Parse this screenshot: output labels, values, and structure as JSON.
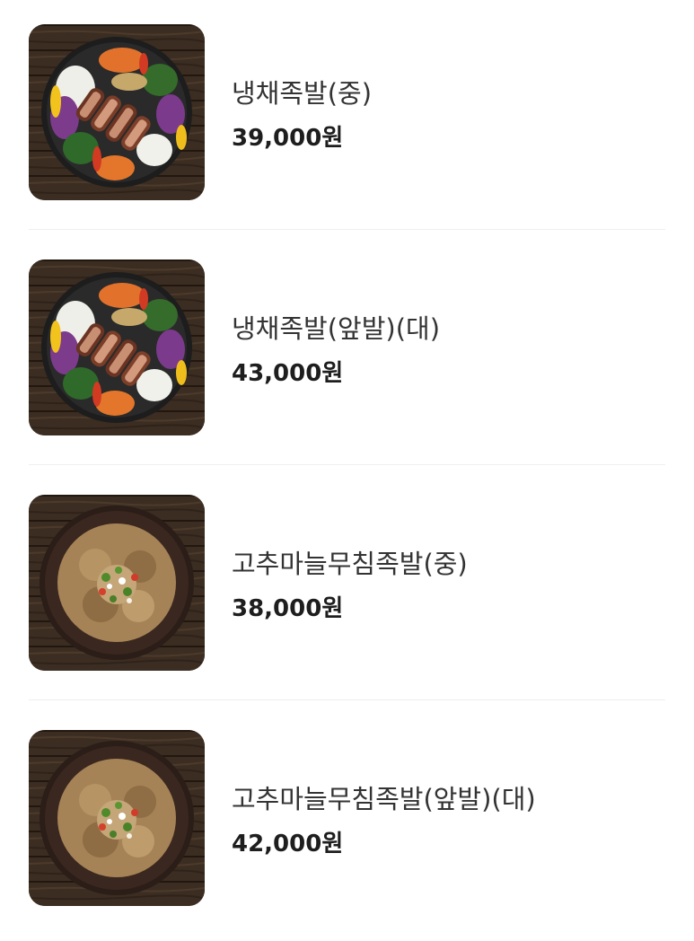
{
  "menu": {
    "items": [
      {
        "name": "냉채족발(중)",
        "price": "39,000원",
        "image": "naengchae-jokbal-photo"
      },
      {
        "name": "냉채족발(앞발)(대)",
        "price": "43,000원",
        "image": "naengchae-jokbal-photo"
      },
      {
        "name": "고추마늘무침족발(중)",
        "price": "38,000원",
        "image": "gochu-maneul-jokbal-photo"
      },
      {
        "name": "고추마늘무침족발(앞발)(대)",
        "price": "42,000원",
        "image": "gochu-maneul-jokbal-photo"
      }
    ]
  }
}
